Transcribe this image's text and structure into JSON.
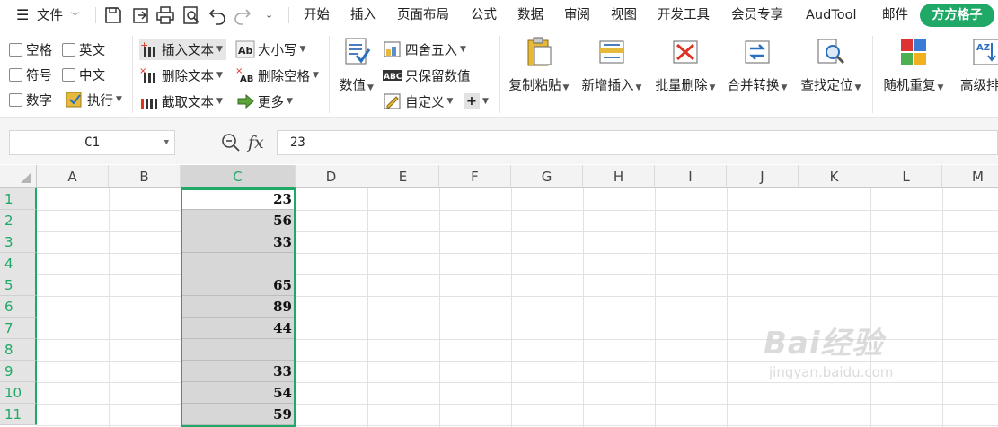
{
  "menubar": {
    "file_label": "文件",
    "tabs": [
      "开始",
      "插入",
      "页面布局",
      "公式",
      "数据",
      "审阅",
      "视图",
      "开发工具",
      "会员专享",
      "AudTool",
      "邮件"
    ],
    "active_tab": "方方格子"
  },
  "ribbon": {
    "checkboxes": [
      "空格",
      "英文",
      "符号",
      "中文",
      "数字"
    ],
    "exec_label": "执行",
    "text_ops": [
      "插入文本",
      "删除文本",
      "截取文本"
    ],
    "case_ops": [
      "大小写",
      "删除空格",
      "更多"
    ],
    "value_label": "数值",
    "number_ops": [
      "四舍五入",
      "只保留数值",
      "自定义"
    ],
    "big_buttons": [
      "复制粘贴",
      "新增插入",
      "批量删除",
      "合并转换",
      "查找定位",
      "随机重复",
      "高级排序"
    ]
  },
  "formula_bar": {
    "name_box": "C1",
    "fx_label": "fx",
    "content": "23"
  },
  "grid": {
    "columns": [
      "A",
      "B",
      "C",
      "D",
      "E",
      "F",
      "G",
      "H",
      "I",
      "J",
      "K",
      "L",
      "M"
    ],
    "selected_column": "C",
    "rows": [
      "1",
      "2",
      "3",
      "4",
      "5",
      "6",
      "7",
      "8",
      "9",
      "10",
      "11"
    ],
    "column_c_values": [
      "23",
      "56",
      "33",
      "",
      "65",
      "89",
      "44",
      "",
      "33",
      "54",
      "59"
    ]
  },
  "watermark": {
    "line1": "Bai经验",
    "line2": "jingyan.baidu.com"
  },
  "colors": {
    "accent": "#1fa866",
    "selection_fill": "#d7d7d7"
  }
}
